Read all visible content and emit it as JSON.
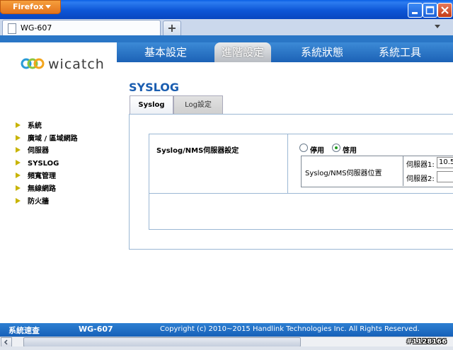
{
  "browser": {
    "app_button": "Firefox",
    "tab_title": "WG-607",
    "new_tab": "+"
  },
  "header": {
    "logo_text": "wicatch",
    "nav": [
      "基本設定",
      "進階設定",
      "系統狀態",
      "系統工具"
    ]
  },
  "content": {
    "page_title": "SYSLOG",
    "subtabs": [
      "Syslog",
      "Log設定"
    ],
    "syslog_nms_label": "Syslog/NMS伺服器設定",
    "disable_label": "停用",
    "enable_label": "啓用",
    "server_location_label": "Syslog/NMS伺服器位置",
    "server1_label": "伺服器1:",
    "server1_value": "10.5",
    "server2_label": "伺服器2:",
    "server2_value": ""
  },
  "sidebar": {
    "items": [
      "系統",
      "廣域 / 區域網路",
      "伺服器",
      "SYSLOG",
      "頻寬管理",
      "無線網路",
      "防火牆"
    ]
  },
  "footer": {
    "brand": "系統速查",
    "model": "WG-607",
    "copyright": "Copyright (c) 2010~2015 Handlink Technologies Inc. All Rights Reserved."
  },
  "watermark": "#1128166",
  "colors": {
    "accent": "#2a76c6",
    "title": "#1a5db0"
  }
}
